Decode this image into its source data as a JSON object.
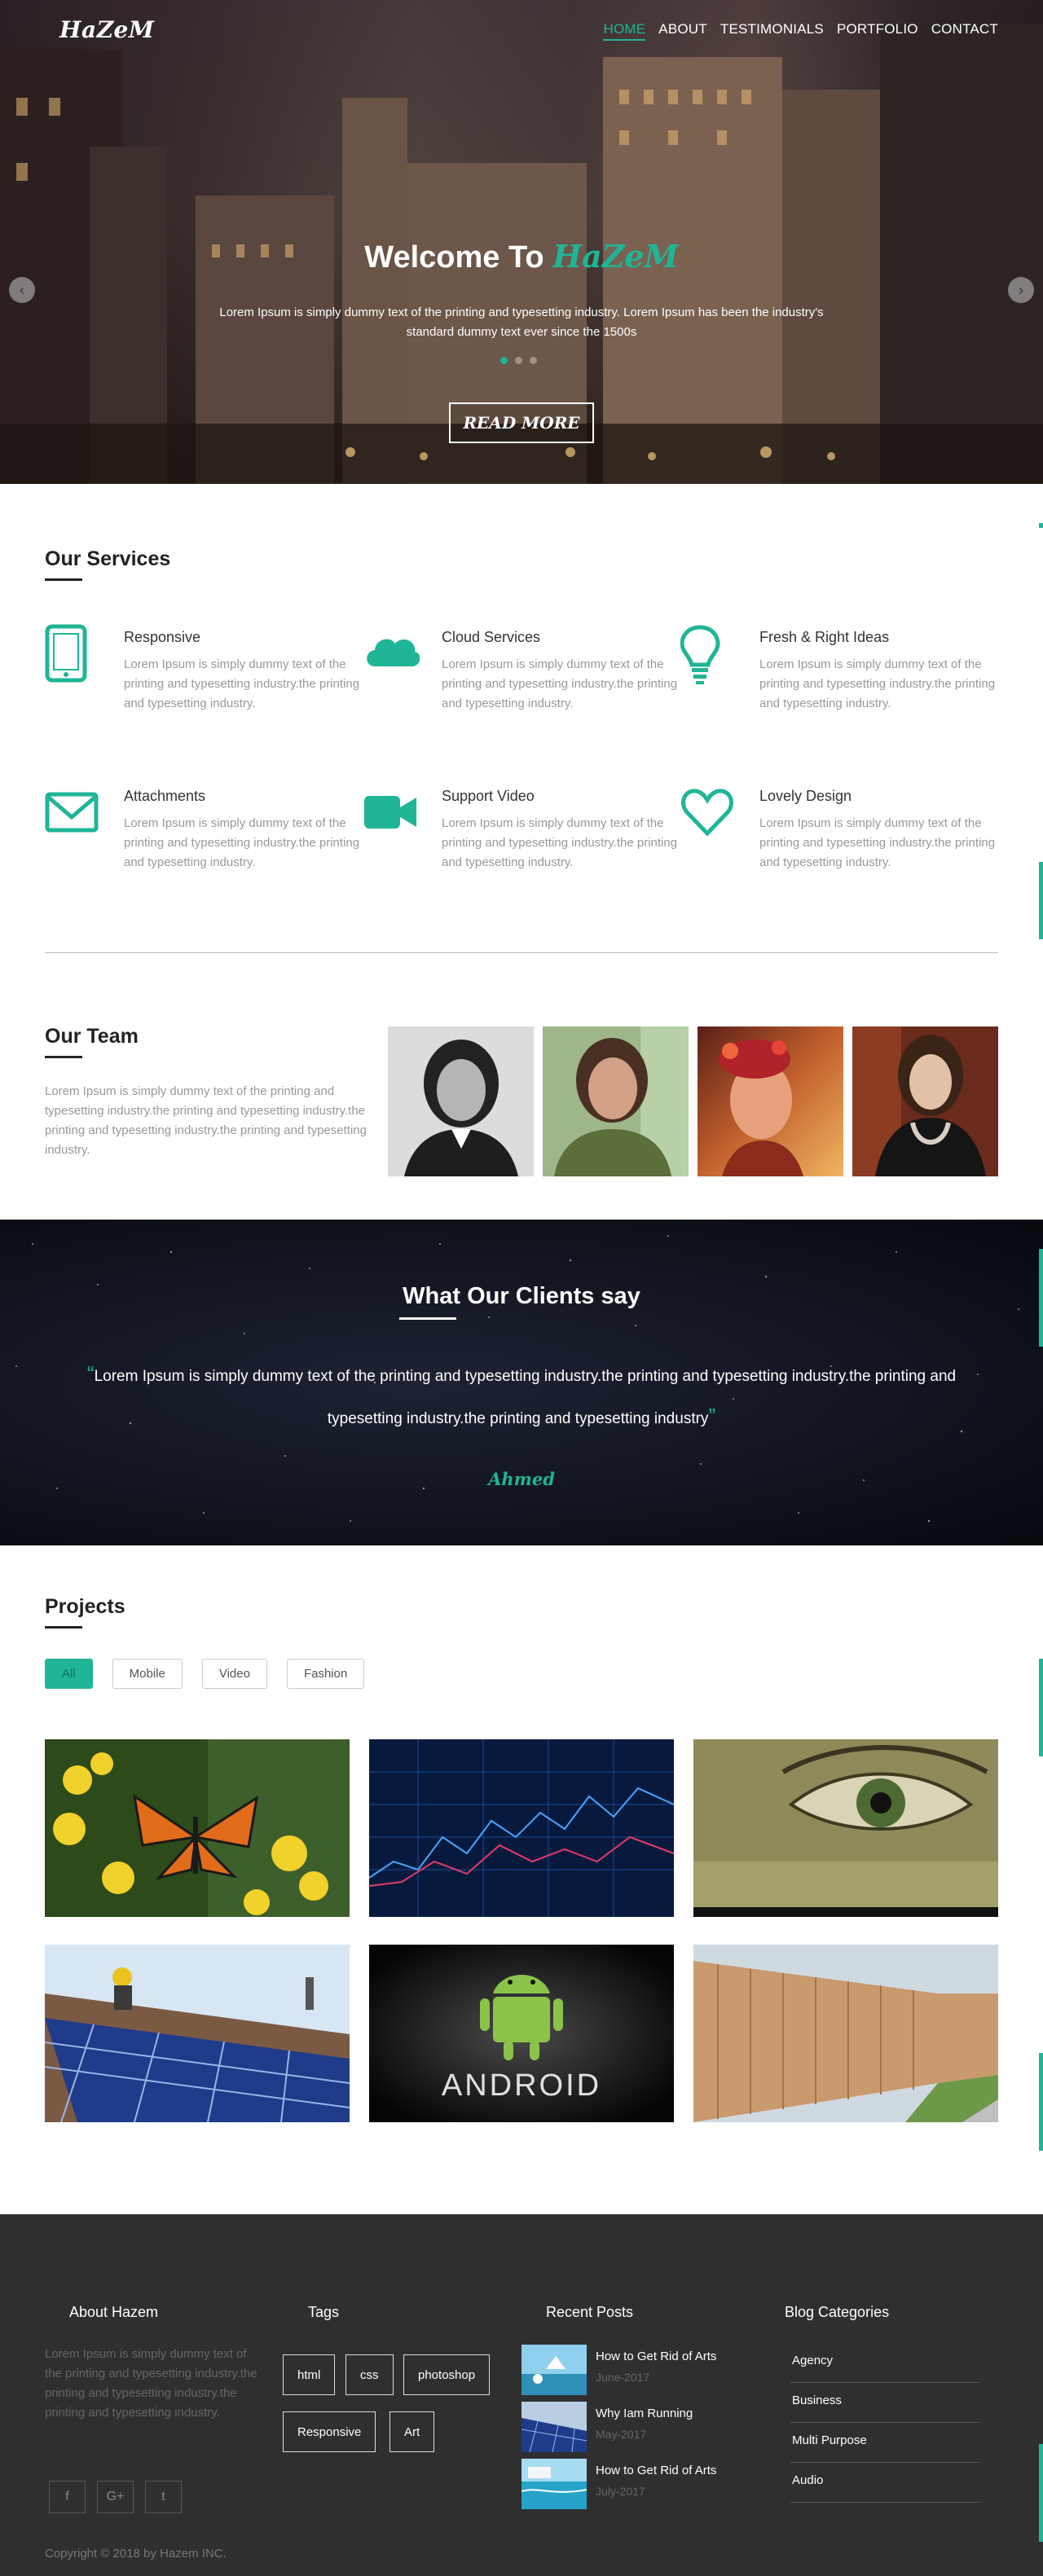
{
  "brand": {
    "logo": "HaZeM"
  },
  "nav": [
    {
      "label": "HOME",
      "active": true
    },
    {
      "label": "ABOUT"
    },
    {
      "label": "TESTIMONIALS"
    },
    {
      "label": "PORTFOLIO"
    },
    {
      "label": "CONTACT"
    }
  ],
  "hero": {
    "title_prefix": "Welcome To",
    "title_brand": "HaZeM",
    "lead": "Lorem Ipsum is simply dummy text of the printing and typesetting industry. Lorem Ipsum has been the industry's standard dummy text ever since the 1500s",
    "button": "READ MORE",
    "prev_arrow": "‹",
    "next_arrow": "›",
    "slides_total": 3,
    "slide_active": 1
  },
  "services": {
    "title": "Our Services",
    "items": [
      {
        "title": "Responsive",
        "text": "Lorem Ipsum is simply dummy text of the printing and typesetting industry.the printing and typesetting industry.",
        "icon": "tablet-icon"
      },
      {
        "title": "Cloud Services",
        "text": "Lorem Ipsum is simply dummy text of the printing and typesetting industry.the printing and typesetting industry.",
        "icon": "cloud-icon"
      },
      {
        "title": "Fresh & Right Ideas",
        "text": "Lorem Ipsum is simply dummy text of the printing and typesetting industry.the printing and typesetting industry.",
        "icon": "lightbulb-icon"
      },
      {
        "title": "Attachments",
        "text": "Lorem Ipsum is simply dummy text of the printing and typesetting industry.the printing and typesetting industry.",
        "icon": "envelope-icon"
      },
      {
        "title": "Support Video",
        "text": "Lorem Ipsum is simply dummy text of the printing and typesetting industry.the printing and typesetting industry.",
        "icon": "video-camera-icon"
      },
      {
        "title": "Lovely Design",
        "text": "Lorem Ipsum is simply dummy text of the printing and typesetting industry.the printing and typesetting industry.",
        "icon": "heart-icon"
      }
    ]
  },
  "team": {
    "title": "Our Team",
    "text": "Lorem Ipsum is simply dummy text of the printing and typesetting industry.the printing and typesetting industry.the printing and typesetting industry.the printing and typesetting industry."
  },
  "clients": {
    "title": "What Our Clients say",
    "open_quote": "“",
    "close_quote": "”",
    "quote": "Lorem Ipsum is simply dummy text of the printing and typesetting industry.the printing and typesetting industry.the printing and typesetting industry.the printing and typesetting industry",
    "author": "Ahmed"
  },
  "projects": {
    "title": "Projects",
    "filters": [
      {
        "label": "All",
        "active": true
      },
      {
        "label": "Mobile"
      },
      {
        "label": "Video"
      },
      {
        "label": "Fashion"
      }
    ]
  },
  "footer": {
    "about_title": "About Hazem",
    "about_text": "Lorem Ipsum is simply dummy text of the printing and typesetting industry.the printing and typesetting industry.the printing and typesetting industry.",
    "social": [
      {
        "glyph": "f",
        "icon": "facebook-icon"
      },
      {
        "glyph": "G+",
        "icon": "google-plus-icon"
      },
      {
        "glyph": "t",
        "icon": "twitter-icon"
      }
    ],
    "tags_title": "Tags",
    "tags": [
      "html",
      "css",
      "photoshop",
      "Responsive",
      "Art"
    ],
    "posts_title": "Recent Posts",
    "posts": [
      {
        "title": "How to Get Rid of Arts",
        "date": "June-2017"
      },
      {
        "title": "Why Iam Running",
        "date": "May-2017"
      },
      {
        "title": "How to Get Rid of Arts",
        "date": "July-2017"
      }
    ],
    "categories_title": "Blog Categories",
    "categories": [
      "Agency",
      "Business",
      "Multi Purpose",
      "Audio"
    ],
    "copyright": "Copyright © 2018 by Hazem INC."
  },
  "colors": {
    "accent": "#1fb596",
    "footer_bg": "#2f2f2f",
    "text_muted": "#999999"
  }
}
